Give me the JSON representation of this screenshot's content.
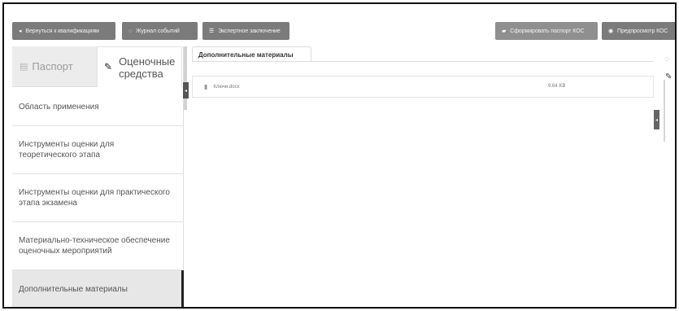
{
  "toolbar": {
    "back_label": "Вернуться к квалификациям",
    "journal_label": "Журнал событий",
    "expert_label": "Экспертное заключение",
    "form_passport_label": "Сформировать паспорт КОС",
    "preview_label": "Предпросмотр КОС"
  },
  "left": {
    "tabs": [
      {
        "label": "Паспорт",
        "icon": "card-icon"
      },
      {
        "label": "Оценочные средства",
        "icon": "pencil-icon"
      }
    ],
    "menu": [
      {
        "label": "Область применения"
      },
      {
        "label": "Инструменты оценки для теоретического этапа"
      },
      {
        "label": "Инструменты оценки для практического этапа экзамена"
      },
      {
        "label": "Материально-техническое обеспечение оценочных мероприятий"
      },
      {
        "label": "Дополнительные материалы",
        "active": true
      }
    ]
  },
  "main": {
    "tab_label": "Дополнительные материалы",
    "files": [
      {
        "name": "Ключи.docx",
        "size": "9.64 KB",
        "icon": "file-icon"
      }
    ]
  },
  "colors": {
    "button_bg": "#7b7b7b",
    "active_item_bg": "#e7e7e7",
    "frame_border": "#111111"
  }
}
